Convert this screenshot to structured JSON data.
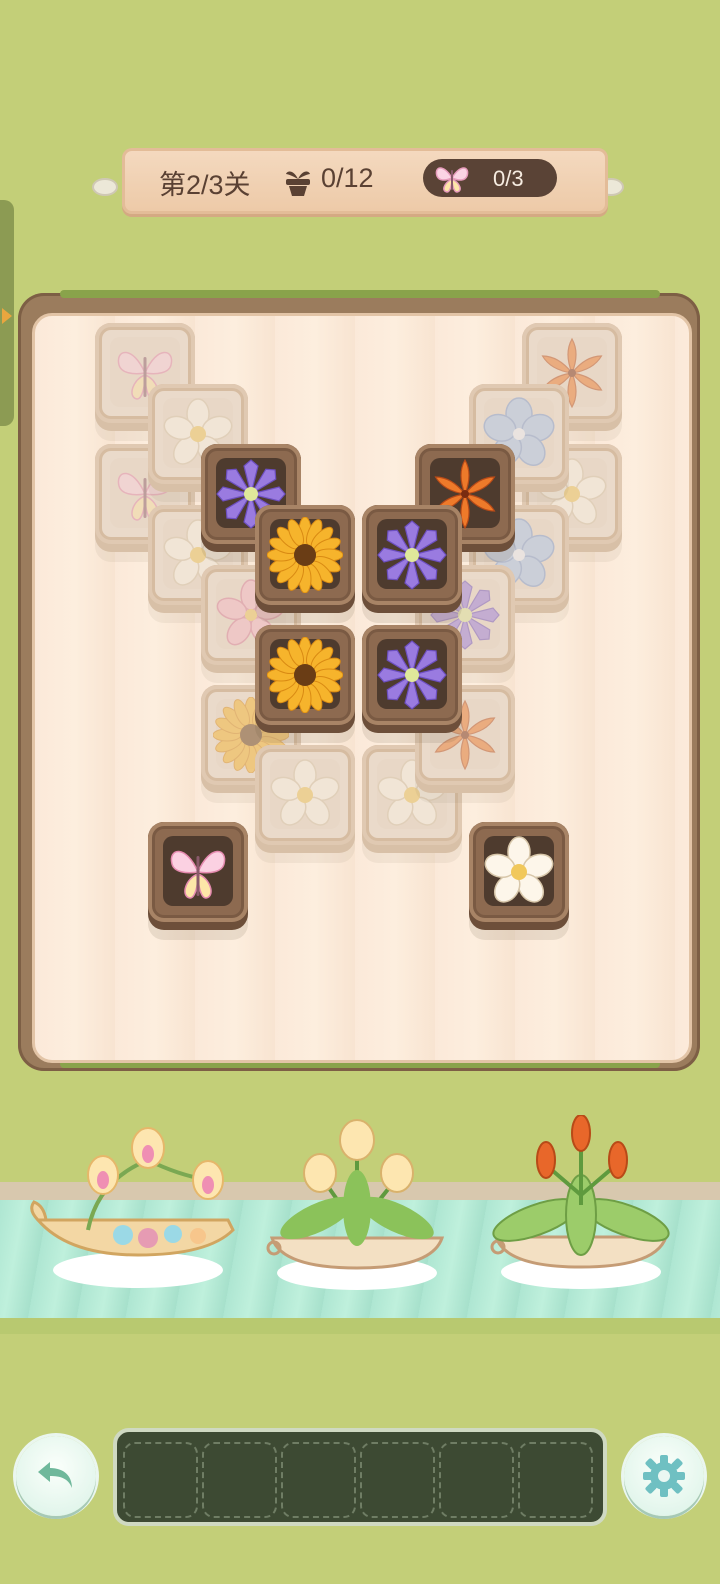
{
  "hud": {
    "level_text": "第2/3关",
    "pots_progress": "0/12",
    "butterflies_progress": "0/3",
    "pot_icon": "flowerpot-icon",
    "butterfly_icon": "butterfly-icon"
  },
  "tiles": [
    {
      "id": "t1",
      "flower": "butterfly",
      "state": "blocked"
    },
    {
      "id": "t2",
      "flower": "white-plumeria",
      "state": "blocked"
    },
    {
      "id": "t3",
      "flower": "butterfly",
      "state": "blocked"
    },
    {
      "id": "t4",
      "flower": "white-plumeria",
      "state": "blocked"
    },
    {
      "id": "t5",
      "flower": "purple-clematis",
      "state": "open"
    },
    {
      "id": "t6",
      "flower": "pink-flower",
      "state": "blocked"
    },
    {
      "id": "t7",
      "flower": "sunflower",
      "state": "blocked"
    },
    {
      "id": "t8",
      "flower": "sunflower",
      "state": "open"
    },
    {
      "id": "t9",
      "flower": "sunflower",
      "state": "open"
    },
    {
      "id": "t10",
      "flower": "white-plumeria",
      "state": "blocked"
    },
    {
      "id": "t11",
      "flower": "orange-lily",
      "state": "blocked"
    },
    {
      "id": "t12",
      "flower": "blue-flower",
      "state": "blocked"
    },
    {
      "id": "t13",
      "flower": "orange-lily",
      "state": "open"
    },
    {
      "id": "t14",
      "flower": "white-plumeria",
      "state": "blocked"
    },
    {
      "id": "t15",
      "flower": "blue-flower",
      "state": "blocked"
    },
    {
      "id": "t16",
      "flower": "purple-clematis",
      "state": "open"
    },
    {
      "id": "t17",
      "flower": "purple-clematis",
      "state": "blocked"
    },
    {
      "id": "t18",
      "flower": "purple-clematis",
      "state": "open"
    },
    {
      "id": "t19",
      "flower": "white-plumeria",
      "state": "blocked"
    },
    {
      "id": "t20",
      "flower": "orange-lily",
      "state": "blocked"
    },
    {
      "id": "t21",
      "flower": "butterfly",
      "state": "open"
    },
    {
      "id": "t22",
      "flower": "white-plumeria",
      "state": "open"
    }
  ],
  "pots": [
    {
      "name": "boat-pot-butterfly-bouquet"
    },
    {
      "name": "pot-white-buds"
    },
    {
      "name": "pot-orange-buds"
    }
  ],
  "tray": {
    "slots": 6,
    "filled": 0
  },
  "buttons": {
    "undo_icon": "undo-icon",
    "settings_icon": "gear-icon"
  },
  "colors": {
    "background": "#c3cf78",
    "tray": "#3d4a33",
    "tile_wood": "#8d6a50"
  }
}
